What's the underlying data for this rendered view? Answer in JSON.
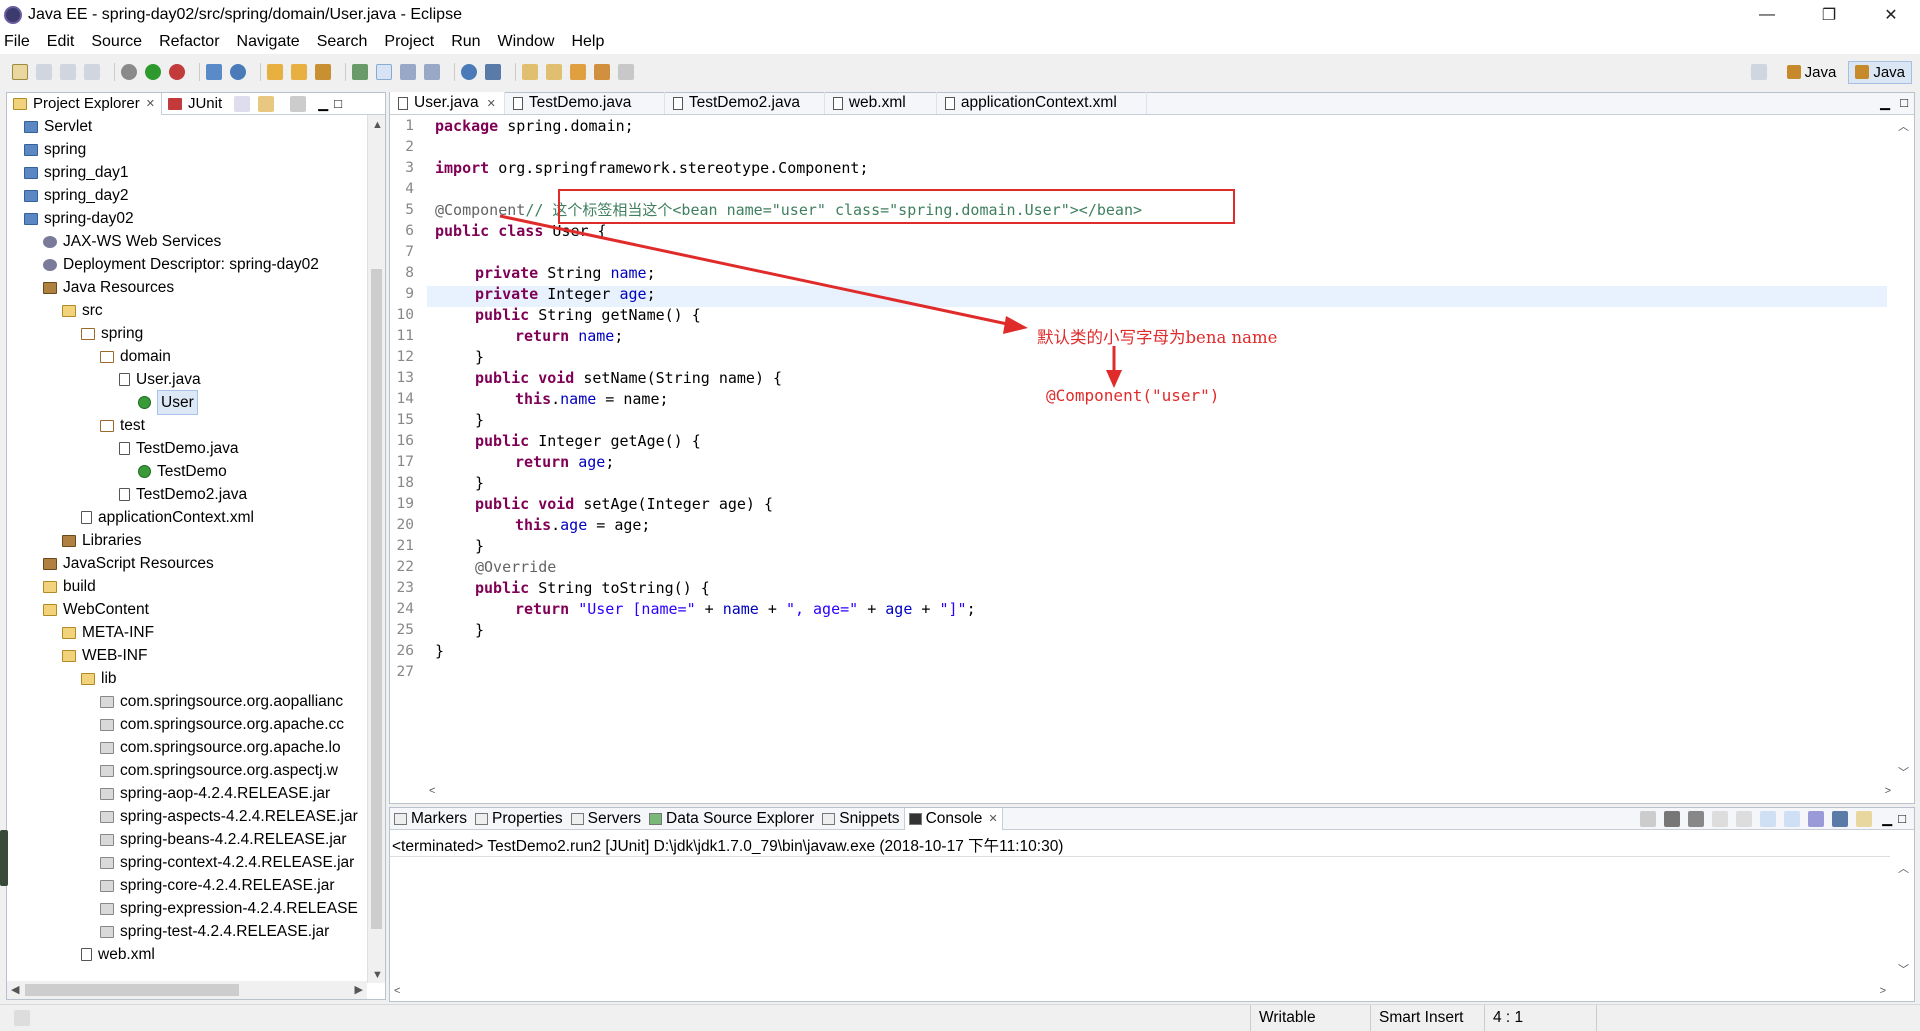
{
  "window": {
    "title": "Java EE - spring-day02/src/spring/domain/User.java - Eclipse",
    "minimize": "—",
    "restore": "❐",
    "close": "✕"
  },
  "menu": [
    "File",
    "Edit",
    "Source",
    "Refactor",
    "Navigate",
    "Search",
    "Project",
    "Run",
    "Window",
    "Help"
  ],
  "perspectives": [
    {
      "label": "Java"
    },
    {
      "label": "Java"
    }
  ],
  "explorer": {
    "tabs": [
      "Project Explorer",
      "JUnit"
    ],
    "tree": [
      {
        "label": "Servlet",
        "icon": "project-icon"
      },
      {
        "label": "spring",
        "icon": "project-icon"
      },
      {
        "label": "spring_day1",
        "icon": "project-icon"
      },
      {
        "label": "spring_day2",
        "icon": "project-icon"
      },
      {
        "label": "spring-day02",
        "icon": "project-icon"
      },
      {
        "label": "JAX-WS Web Services",
        "icon": "webservice-icon"
      },
      {
        "label": "Deployment Descriptor: spring-day02",
        "icon": "descriptor-icon"
      },
      {
        "label": "Java Resources",
        "icon": "java-resources-icon"
      },
      {
        "label": "src",
        "icon": "source-folder-icon"
      },
      {
        "label": "spring",
        "icon": "package-icon"
      },
      {
        "label": "domain",
        "icon": "package-icon"
      },
      {
        "label": "User.java",
        "icon": "java-file-icon"
      },
      {
        "label": "User",
        "icon": "class-icon"
      },
      {
        "label": "test",
        "icon": "package-icon"
      },
      {
        "label": "TestDemo.java",
        "icon": "java-file-icon"
      },
      {
        "label": "TestDemo",
        "icon": "class-icon"
      },
      {
        "label": "TestDemo2.java",
        "icon": "java-file-icon"
      },
      {
        "label": "applicationContext.xml",
        "icon": "xml-file-icon"
      },
      {
        "label": "Libraries",
        "icon": "library-icon"
      },
      {
        "label": "JavaScript Resources",
        "icon": "js-resources-icon"
      },
      {
        "label": "build",
        "icon": "folder-icon"
      },
      {
        "label": "WebContent",
        "icon": "folder-icon"
      },
      {
        "label": "META-INF",
        "icon": "folder-icon"
      },
      {
        "label": "WEB-INF",
        "icon": "folder-icon"
      },
      {
        "label": "lib",
        "icon": "folder-icon"
      },
      {
        "label": "com.springsource.org.aopallianc",
        "icon": "jar-icon"
      },
      {
        "label": "com.springsource.org.apache.cc",
        "icon": "jar-icon"
      },
      {
        "label": "com.springsource.org.apache.lo",
        "icon": "jar-icon"
      },
      {
        "label": "com.springsource.org.aspectj.w",
        "icon": "jar-icon"
      },
      {
        "label": "spring-aop-4.2.4.RELEASE.jar",
        "icon": "jar-icon"
      },
      {
        "label": "spring-aspects-4.2.4.RELEASE.jar",
        "icon": "jar-icon"
      },
      {
        "label": "spring-beans-4.2.4.RELEASE.jar",
        "icon": "jar-icon"
      },
      {
        "label": "spring-context-4.2.4.RELEASE.jar",
        "icon": "jar-icon"
      },
      {
        "label": "spring-core-4.2.4.RELEASE.jar",
        "icon": "jar-icon"
      },
      {
        "label": "spring-expression-4.2.4.RELEASE",
        "icon": "jar-icon"
      },
      {
        "label": "spring-test-4.2.4.RELEASE.jar",
        "icon": "jar-icon"
      },
      {
        "label": "web.xml",
        "icon": "xml-file-icon"
      }
    ]
  },
  "editor": {
    "tabs": [
      "User.java",
      "TestDemo.java",
      "TestDemo2.java",
      "web.xml",
      "applicationContext.xml"
    ],
    "lines": [
      "1",
      "2",
      "3",
      "4",
      "5",
      "6",
      "7",
      "8",
      "9",
      "10",
      "11",
      "12",
      "13",
      "14",
      "15",
      "16",
      "17",
      "18",
      "19",
      "20",
      "21",
      "22",
      "23",
      "24",
      "25",
      "26",
      "27"
    ],
    "code": {
      "l1_kw": "package",
      "l1_rest": " spring.domain;",
      "l3_kw": "import",
      "l3_rest": " org.springframework.stereotype.Component;",
      "l5_ann": "@Component",
      "l5_cmt": "// 这个标签相当这个<bean name=\"user\" class=\"spring.domain.User\"></bean>",
      "l6_kw": "public class",
      "l6_rest": " User {",
      "l8_kw": "private",
      "l8_type": " String ",
      "l8_fld": "name",
      "l9_kw": "private",
      "l9_type": " Integer ",
      "l9_fld": "age",
      "l10_kw": "public",
      "l10_rest": " String getName() {",
      "l11_kw": "return",
      "l11_fld": "name",
      "l12": "}",
      "l13_kw": "public void",
      "l13_rest": " setName(String name) {",
      "l14_kw": "this",
      "l14_fld": "name",
      "l14_rest": " = name;",
      "l15": "}",
      "l16_kw": "public",
      "l16_rest": " Integer getAge() {",
      "l17_kw": "return",
      "l17_fld": "age",
      "l18": "}",
      "l19_kw": "public void",
      "l19_rest": " setAge(Integer age) {",
      "l20_kw": "this",
      "l20_fld": "age",
      "l20_rest": " = age;",
      "l21": "}",
      "l22_ann": "@Override",
      "l23_kw": "public",
      "l23_rest": " String toString() {",
      "l24_kw": "return",
      "l24_s1": "\"User [name=\"",
      "l24_p1": " + ",
      "l24_f1": "name",
      "l24_p2": " + ",
      "l24_s2": "\", age=\"",
      "l24_p3": " + ",
      "l24_f2": "age",
      "l24_p4": " + ",
      "l24_s3": "\"]\"",
      "l24_end": ";",
      "l25": "}",
      "l26": "}"
    },
    "annotations": {
      "callout_default_name": "默认类的小写字母为bena name",
      "callout_component": "@Component(\"user\")"
    }
  },
  "console": {
    "tabs": [
      "Markers",
      "Properties",
      "Servers",
      "Data Source Explorer",
      "Snippets",
      "Console"
    ],
    "status": "<terminated> TestDemo2.run2 [JUnit] D:\\jdk\\jdk1.7.0_79\\bin\\javaw.exe (2018-10-17 下午11:10:30)"
  },
  "statusbar": {
    "writable": "Writable",
    "insert_mode": "Smart Insert",
    "position": "4 : 1"
  },
  "colors": {
    "keyword": "#7f0055",
    "field": "#0000c0",
    "string": "#2a00ff",
    "comment": "#3f7f5f",
    "annotation_red": "#e02b2b"
  }
}
